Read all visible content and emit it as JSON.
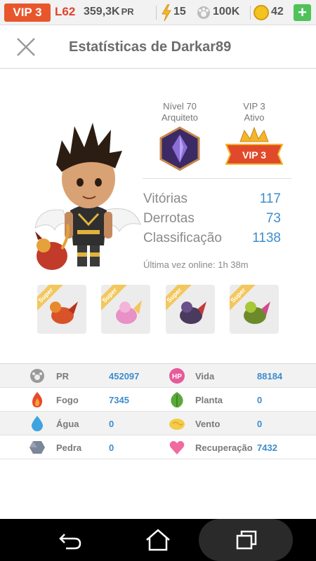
{
  "status_bar": {
    "vip": "VIP 3",
    "level": "L62",
    "pr": "359,3K",
    "pr_suffix": "PR",
    "energy": "15",
    "food": "100K",
    "gems": "42",
    "plus": "+"
  },
  "header": {
    "title": "Estatísticas de Darkar89"
  },
  "profile": {
    "level_line1": "Nível 70",
    "level_line2": "Arquiteto",
    "vip_line1": "VIP 3",
    "vip_line2": "Ativo",
    "vip_badge_text": "VIP 3",
    "stats": [
      {
        "label": "Vitórias",
        "value": "117"
      },
      {
        "label": "Derrotas",
        "value": "73"
      },
      {
        "label": "Classificação",
        "value": "1138"
      }
    ],
    "last_online": "Última vez online: 1h 38m",
    "dragon_ribbon": "Super"
  },
  "table": {
    "rows": [
      {
        "l_label": "PR",
        "l_value": "452097",
        "r_label": "Vida",
        "r_value": "88184",
        "r_icon_text": "HP"
      },
      {
        "l_label": "Fogo",
        "l_value": "7345",
        "r_label": "Planta",
        "r_value": "0"
      },
      {
        "l_label": "Água",
        "l_value": "0",
        "r_label": "Vento",
        "r_value": "0"
      },
      {
        "l_label": "Pedra",
        "l_value": "0",
        "r_label": "Recuperação",
        "r_value": "7432"
      }
    ]
  },
  "colors": {
    "vip_orange": "#e8562c",
    "value_blue": "#3d8ccd",
    "plus_green": "#4fc25a"
  },
  "icons": [
    "close-icon",
    "energy-icon",
    "food-icon",
    "gem-icon",
    "back-icon",
    "home-icon",
    "recents-icon"
  ]
}
